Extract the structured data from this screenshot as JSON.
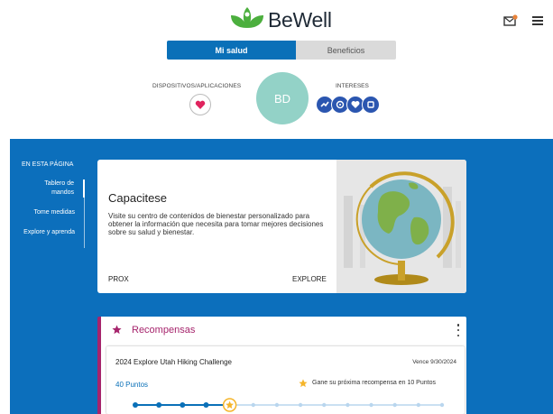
{
  "header": {
    "brand": "BeWell"
  },
  "toggle": {
    "active": "Mi salud",
    "inactive": "Beneficios"
  },
  "profile": {
    "devices_label": "DISPOSITIVOS/APLICACIONES",
    "initials": "BD",
    "interests_label": "INTERESES"
  },
  "sidebar": {
    "title": "EN ESTA PÁGINA",
    "items": [
      {
        "label": "Tablero de mandos"
      },
      {
        "label": "Tome medidas"
      },
      {
        "label": "Explore y aprenda"
      }
    ]
  },
  "card": {
    "title": "Capacitese",
    "description": "Visite su centro de contenidos de bienestar personalizado para obtener la información que necesita para tomar mejores decisiones sobre su salud y bienestar.",
    "prev_label": "PROX",
    "explore_label": "EXPLORE"
  },
  "rewards": {
    "title": "Recompensas",
    "challenge": {
      "name": "2024 Explore Utah Hiking Challenge",
      "due": "Vence 9/30/2024",
      "points": "40 Puntos",
      "next_reward": "Gane su próxima recompensa en 10 Puntos",
      "progress_total_steps": 14,
      "progress_completed_steps": 4,
      "progress_current_step": 5
    }
  },
  "colors": {
    "brand_blue": "#0c6fbc",
    "accent_magenta": "#a6246c",
    "logo_green": "#4caf3e",
    "star_gold": "#f5b52a",
    "avatar_mint": "#93d2c7"
  }
}
